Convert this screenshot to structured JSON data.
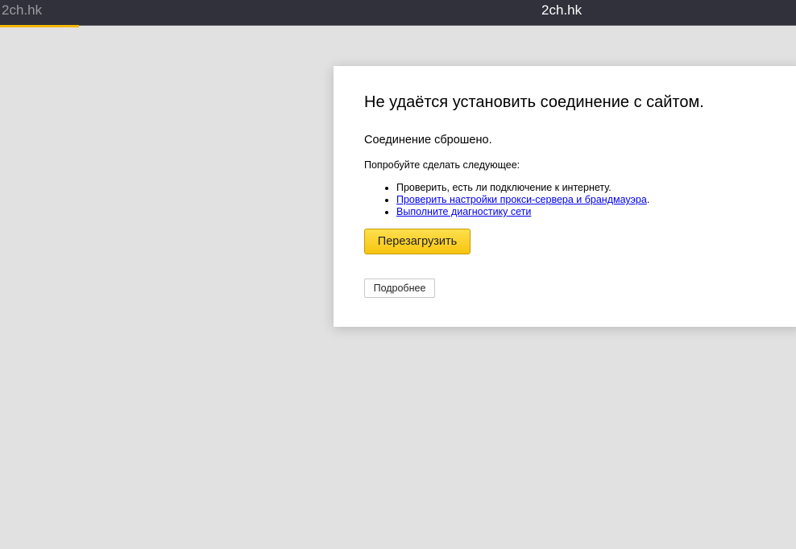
{
  "titlebar": {
    "tab_title": "2ch.hk",
    "window_title": "2ch.hk"
  },
  "colors": {
    "titlebar_bg": "#30313a",
    "progress_accent": "#f5b800",
    "page_bg": "#e1e1e1",
    "reload_button": "#fcd530",
    "link": "#0000ee"
  },
  "error_page": {
    "heading": "Не удаётся установить соединение с сайтом.",
    "subheading": "Соединение сброшено.",
    "try_text": "Попробуйте сделать следующее:",
    "suggestions": [
      {
        "text": "Проверить, есть ли подключение к интернету.",
        "is_link": false
      },
      {
        "text": "Проверить настройки прокси-сервера и брандмауэра",
        "suffix": ".",
        "is_link": true
      },
      {
        "text": "Выполните диагностику сети",
        "is_link": true
      }
    ],
    "reload_button_label": "Перезагрузить",
    "details_button_label": "Подробнее"
  }
}
